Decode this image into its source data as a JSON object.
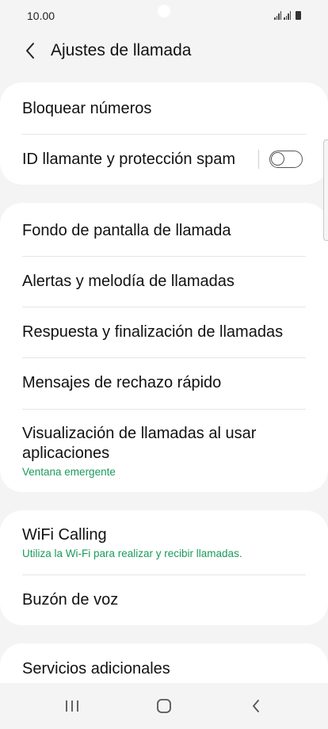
{
  "status_bar": {
    "time": "10.00"
  },
  "header": {
    "title": "Ajustes de llamada",
    "back_icon": "chevron-left-icon"
  },
  "sections": {
    "block": {
      "block_numbers": "Bloquear números",
      "caller_id": "ID llamante y protección spam",
      "caller_id_toggle": false
    },
    "call": {
      "background": "Fondo de pantalla de llamada",
      "alerts": "Alertas y melodía de llamadas",
      "answer_end": "Respuesta y finalización de llamadas",
      "quick_decline": "Mensajes de rechazo rápido",
      "display_title": "Visualización de llamadas al usar aplicaciones",
      "display_sub": "Ventana emergente"
    },
    "wifi": {
      "wifi_title": "WiFi Calling",
      "wifi_sub": "Utiliza la Wi-Fi para realizar y recibir llamadas.",
      "voicemail": "Buzón de voz"
    },
    "more": {
      "additional": "Servicios adicionales"
    }
  },
  "colors": {
    "accent_green": "#1a9a5c",
    "background": "#f4f4f4",
    "card": "#ffffff"
  },
  "nav_bar": {
    "recent_icon": "recent-apps-icon",
    "home_icon": "home-icon",
    "back_icon": "back-icon"
  }
}
